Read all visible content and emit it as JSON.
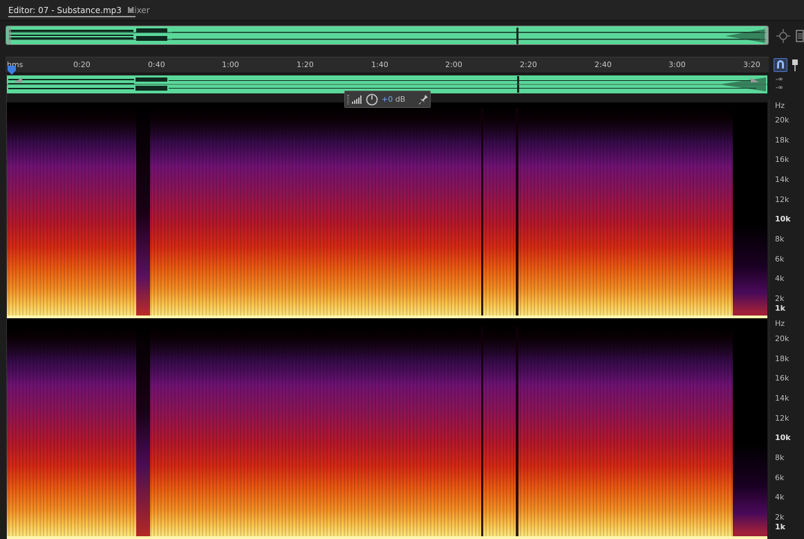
{
  "tabs": {
    "editor_label": "Editor: 07 - Substance.mp3",
    "mixer_label": "Mixer"
  },
  "icons": {
    "tab_menu": "hamburger-menu-icon",
    "zoom": "zoom-navigator-icon",
    "panel": "panel-list-icon",
    "snap": "snap-magnet-icon",
    "marker": "marker-pin-icon",
    "playhead": "playhead-icon",
    "volume": "volume-bars-icon",
    "knob": "volume-knob-icon",
    "pin": "pin-icon"
  },
  "ruler": {
    "labels": [
      "hms",
      "0:20",
      "0:40",
      "1:00",
      "1:20",
      "1:40",
      "2:00",
      "2:20",
      "2:40",
      "3:00",
      "3:20"
    ]
  },
  "levels": {
    "top": "-∞",
    "bottom": "-∞"
  },
  "hud": {
    "value": "+0",
    "unit": "dB"
  },
  "frequency_axis": {
    "unit": "Hz",
    "labels": [
      "20k",
      "18k",
      "16k",
      "14k",
      "12k",
      "10k",
      "8k",
      "6k",
      "4k",
      "2k",
      "1k"
    ]
  },
  "colors": {
    "waveform": "#5ad89a",
    "accent": "#4a78c8",
    "hud_value": "#6fa5ff"
  }
}
